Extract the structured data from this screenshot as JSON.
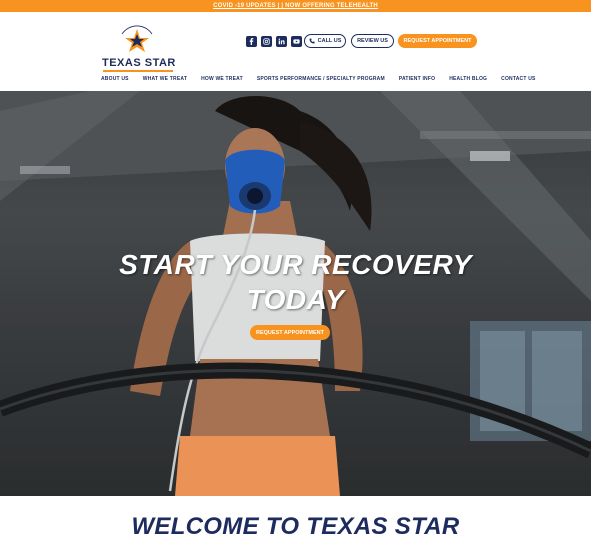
{
  "topbar": {
    "text": "COVID -19 UPDATES | | NOW OFFERING TELEHEALTH"
  },
  "header": {
    "logo_text": "TEXAS STAR",
    "social": [
      "facebook-icon",
      "instagram-icon",
      "linkedin-icon",
      "youtube-icon"
    ],
    "call_label": "CALL US",
    "review_label": "REVIEW US",
    "request_label": "REQUEST APPOINTMENT"
  },
  "nav": {
    "items": [
      "ABOUT US",
      "WHAT WE TREAT",
      "HOW WE TREAT",
      "SPORTS PERFORMANCE / SPECIALTY PROGRAM",
      "PATIENT INFO",
      "HEALTH BLOG",
      "CONTACT US"
    ]
  },
  "hero": {
    "title_line1": "START YOUR RECOVERY",
    "title_line2": "TODAY",
    "button_label": "REQUEST APPOINTMENT"
  },
  "welcome": {
    "title": "WELCOME TO TEXAS STAR"
  },
  "colors": {
    "brand_orange": "#f7931e",
    "brand_navy": "#1d2c5e"
  }
}
